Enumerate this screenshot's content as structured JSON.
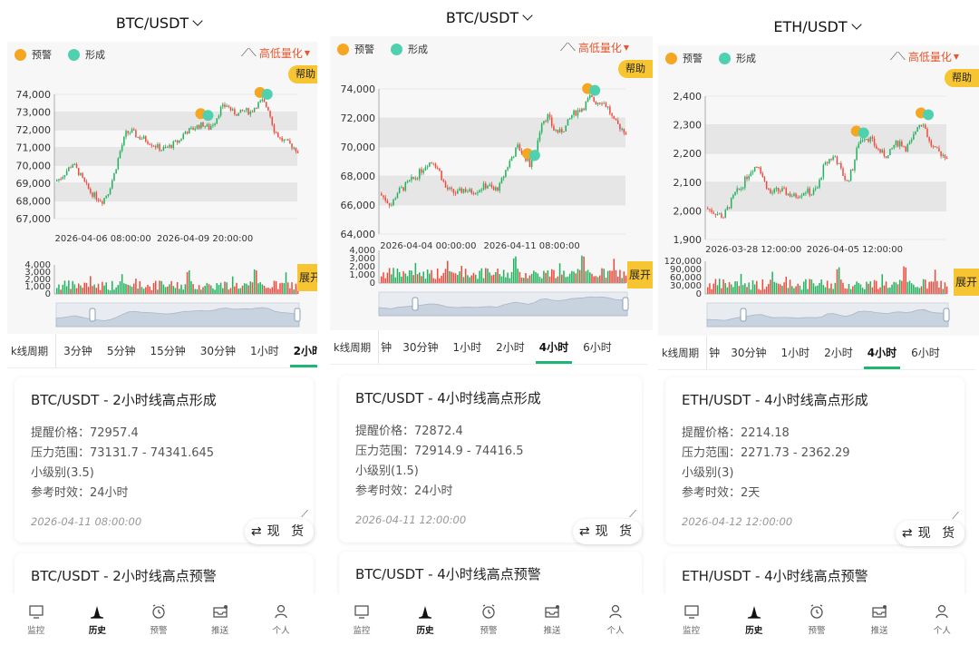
{
  "legend": {
    "warn_label": "预警",
    "form_label": "形成",
    "warn_color": "#f5a623",
    "form_color": "#4fd1b0"
  },
  "quant_label": "高低量化",
  "quant_icon": "trend-wave-icon",
  "help_label": "帮助",
  "expand_label": "展开",
  "period_label": "k线周期",
  "nav": [
    {
      "label": "监控",
      "icon": "monitor-icon"
    },
    {
      "label": "历史",
      "icon": "history-chart-icon"
    },
    {
      "label": "预警",
      "icon": "alarm-clock-icon"
    },
    {
      "label": "推送",
      "icon": "push-inbox-icon"
    },
    {
      "label": "个人",
      "icon": "person-icon"
    }
  ],
  "colors": {
    "up": "#22b35e",
    "down": "#ee4b3f",
    "accent": "#1fb574",
    "help_bg": "#f7c531"
  },
  "panels": [
    {
      "pair": "BTC/USDT",
      "chart_data": {
        "type": "candlestick",
        "y_ticks": [
          "74,000",
          "73,000",
          "72,000",
          "71,000",
          "70,000",
          "69,000",
          "68,000",
          "67,000"
        ],
        "ylim": [
          67000,
          74000
        ],
        "x_labels": [
          "2026-04-06 08:00:00",
          "2026-04-09 20:00:00"
        ],
        "volume_ticks": [
          "4,000",
          "3,000",
          "2,000",
          "1,000",
          "0"
        ],
        "volume_ylim": [
          0,
          4000
        ],
        "price_path": [
          69100,
          69300,
          69700,
          70100,
          69600,
          69000,
          68500,
          68200,
          68000,
          68500,
          69500,
          70800,
          71800,
          71900,
          71600,
          71500,
          71300,
          71100,
          70900,
          71000,
          71200,
          71400,
          71900,
          72000,
          72200,
          72300,
          72100,
          72500,
          73200,
          73400,
          73000,
          72900,
          73100,
          73000,
          73400,
          73600,
          73200,
          72000,
          71500,
          71300,
          71100,
          70800
        ]
      },
      "periods": [
        "3分钟",
        "5分钟",
        "15分钟",
        "30分钟",
        "1小时",
        "2小时"
      ],
      "active_period": 5,
      "card": {
        "title": "BTC/USDT - 2小时线高点形成",
        "price_label": "提醒价格：",
        "price": "72957.4",
        "range_label": "压力范围：",
        "range": "73131.7 - 74341.645",
        "level": "小级别(3.5)",
        "valid_label": "参考时效：",
        "valid": "24小时",
        "time": "2026-04-11 08:00:00"
      },
      "spot_label": "现 货",
      "next_card_title": "BTC/USDT - 2小时线高点预警"
    },
    {
      "pair": "BTC/USDT",
      "chart_data": {
        "type": "candlestick",
        "y_ticks": [
          "74,000",
          "72,000",
          "70,000",
          "68,000",
          "66,000",
          "64,000"
        ],
        "ylim": [
          64000,
          74000
        ],
        "x_labels": [
          "2026-04-04 00:00:00",
          "2026-04-11 08:00:00"
        ],
        "volume_ticks": [
          "4,000",
          "3,000",
          "2,000",
          "1,000",
          "0"
        ],
        "volume_ylim": [
          0,
          4000
        ],
        "price_path": [
          66800,
          66400,
          66000,
          66900,
          67200,
          67600,
          67900,
          68400,
          68900,
          69000,
          68300,
          67200,
          66900,
          66800,
          67100,
          66900,
          67000,
          67200,
          67400,
          67000,
          67300,
          68400,
          69300,
          70000,
          69500,
          68800,
          69800,
          71800,
          72100,
          71200,
          71000,
          71400,
          72200,
          72500,
          72800,
          73400,
          73100,
          73200,
          72700,
          71700,
          71400,
          71000
        ]
      },
      "periods": [
        "钟",
        "30分钟",
        "1小时",
        "2小时",
        "4小时",
        "6小时"
      ],
      "active_period": 4,
      "card": {
        "title": "BTC/USDT - 4小时线高点形成",
        "price_label": "提醒价格：",
        "price": "72872.4",
        "range_label": "压力范围：",
        "range": "72914.9 - 74416.5",
        "level": "小级别(1.5)",
        "valid_label": "参考时效：",
        "valid": "24小时",
        "time": "2026-04-11 12:00:00"
      },
      "spot_label": "现 货",
      "next_card_title": "BTC/USDT - 4小时线高点预警"
    },
    {
      "pair": "ETH/USDT",
      "chart_data": {
        "type": "candlestick",
        "y_ticks": [
          "2,400",
          "2,300",
          "2,200",
          "2,100",
          "2,000",
          "1,900"
        ],
        "ylim": [
          1900,
          2400
        ],
        "x_labels": [
          "2026-03-28 12:00:00",
          "2026-04-05 12:00:00"
        ],
        "volume_ticks": [
          "120,000",
          "90,000",
          "60,000",
          "30,000",
          "0"
        ],
        "volume_ylim": [
          0,
          120000
        ],
        "price_path": [
          2010,
          2000,
          1990,
          1980,
          2020,
          2060,
          2080,
          2120,
          2150,
          2160,
          2100,
          2060,
          2070,
          2070,
          2060,
          2050,
          2060,
          2070,
          2060,
          2080,
          2150,
          2180,
          2190,
          2140,
          2100,
          2150,
          2240,
          2260,
          2250,
          2220,
          2200,
          2190,
          2230,
          2240,
          2220,
          2240,
          2300,
          2310,
          2240,
          2210,
          2200,
          2190
        ]
      },
      "periods": [
        "钟",
        "30分钟",
        "1小时",
        "2小时",
        "4小时",
        "6小时"
      ],
      "active_period": 4,
      "card": {
        "title": "ETH/USDT - 4小时线高点形成",
        "price_label": "提醒价格：",
        "price": "2214.18",
        "range_label": "压力范围：",
        "range": "2271.73 - 2362.29",
        "level": "小级别(3)",
        "valid_label": "参考时效：",
        "valid": "2天",
        "time": "2026-04-12 12:00:00"
      },
      "spot_label": "现 货",
      "next_card_title": "ETH/USDT - 4小时线高点预警"
    }
  ]
}
